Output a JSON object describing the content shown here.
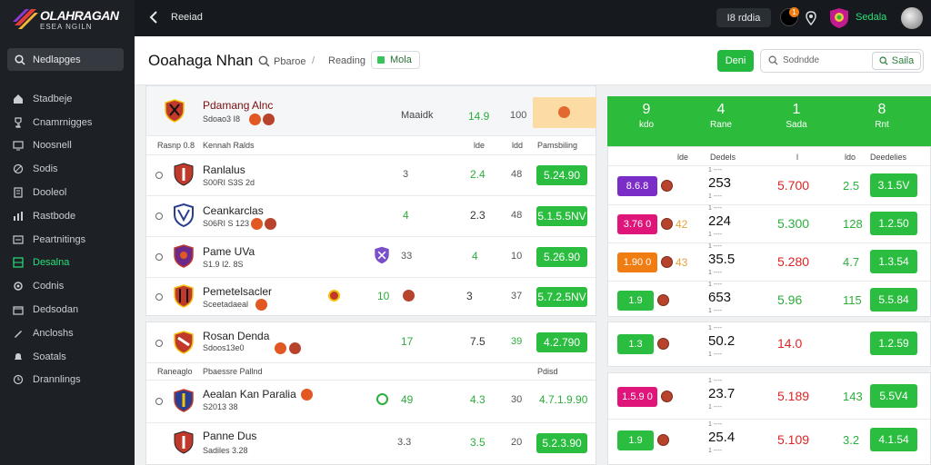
{
  "app": {
    "logo_line1": "OLAHRAGAN",
    "logo_line2": "ESEA NGILN"
  },
  "sidebar": {
    "search_label": "Nedlapges",
    "items": [
      {
        "label": "Stadbeje",
        "icon": "home-icon"
      },
      {
        "label": "Cnamrnigges",
        "icon": "trophy-icon"
      },
      {
        "label": "Noosnell",
        "icon": "monitor-icon"
      },
      {
        "label": "Sodis",
        "icon": "ball-icon"
      },
      {
        "label": "Dooleol",
        "icon": "file-icon"
      },
      {
        "label": "Rastbode",
        "icon": "chart-icon"
      },
      {
        "label": "Peartnitings",
        "icon": "list-icon"
      },
      {
        "label": "Desalna",
        "icon": "grid-icon"
      },
      {
        "label": "Codnis",
        "icon": "settings-icon"
      },
      {
        "label": "Dedsodan",
        "icon": "box-icon"
      },
      {
        "label": "Ancloshs",
        "icon": "pen-icon"
      },
      {
        "label": "Soatals",
        "icon": "bell-icon"
      },
      {
        "label": "Drannlings",
        "icon": "clock-icon"
      }
    ],
    "active_index": 7
  },
  "topbar": {
    "title": "Reeiad",
    "badge_text": "I8 rddia",
    "notif_count": "1",
    "user_label": "Sedala"
  },
  "header": {
    "title": "Ooahaga Nhan",
    "crumb1": "Pbaroe",
    "crumb2": "Reading",
    "chip": "Mola",
    "button": "Deni",
    "search_placeholder": "Sodndde",
    "search_button": "Saila"
  },
  "feature": {
    "name": "Pdamang Alnc",
    "sub": "Sdoao3 I8",
    "col_label": "Maaidk",
    "odd1": "14.9",
    "odd2": "100"
  },
  "table": {
    "col1": "Rasnp 0.8",
    "col2": "Kennah Ralds",
    "col3": "lde",
    "col4": "ldd",
    "col5": "Pamsbiling",
    "section_col1": "Raneaglo",
    "section_col2": "Pbaessre Pallnd",
    "section_col5": "Pdisd"
  },
  "rows": [
    {
      "name": "Ranlalus",
      "sub": "S00RI S3S 2d",
      "mid": "",
      "v1": "3",
      "v2": "2.4",
      "v3": "48",
      "price": "5.24.90"
    },
    {
      "name": "Ceankarclas",
      "sub": "S06RI S 123",
      "mid": "",
      "v1": "4",
      "v2": "2.3",
      "v3": "48",
      "price": "5.1.5.5NV"
    },
    {
      "name": "Pame UVa",
      "sub": "S1.9 I2. 8S",
      "mid": "33",
      "v1": "",
      "v2": "4",
      "v3": "10",
      "price": "5.26.90"
    },
    {
      "name": "Pemetelsacler",
      "sub": "Sceetadaeal",
      "mid": "10",
      "v1": "",
      "v2": "3",
      "v3": "37",
      "price": "5.7.2.5NV"
    },
    {
      "name": "Rosan Denda",
      "sub": "Sdoos13e0",
      "mid": "",
      "v1": "17",
      "v2": "7.5",
      "v3": "39",
      "price": "4.2.790"
    },
    {
      "name": "Aealan Kan Paralia",
      "sub": "S2013 38",
      "mid": "49",
      "v1": "",
      "v2": "4.3",
      "v3": "30",
      "price": "4.7.1.9.90"
    },
    {
      "name": "Panne Dus",
      "sub": "Sadiles 3.28",
      "mid": "",
      "v1": "3.3",
      "v2": "3.5",
      "v3": "20",
      "price": "5.2.3.90"
    }
  ],
  "right": {
    "head": [
      {
        "big": "9",
        "small": "kdo"
      },
      {
        "big": "4",
        "small": "Rane"
      },
      {
        "big": "1",
        "small": "Sada"
      },
      {
        "big": "8",
        "small": "Rnt"
      }
    ],
    "sub_head": {
      "c1": "lde",
      "c2": "Dedels",
      "c3": "l",
      "c4": "ldo",
      "c5": "Deedelies"
    },
    "rows": [
      {
        "tag": "8.6.8",
        "tag_color": "#7b2dc8",
        "n": "",
        "big": "253",
        "odd": "5.700",
        "odd_color": "#e02424",
        "v": "2.5",
        "price": "3.1.5V"
      },
      {
        "tag": "3.76 0",
        "tag_color": "#e0157a",
        "n": "42",
        "big": "224",
        "odd": "5.300",
        "odd_color": "#2cae3d",
        "v": "128",
        "price": "1.2.50"
      },
      {
        "tag": "1.90 0",
        "tag_color": "#f07d12",
        "n": "43",
        "big": "35.5",
        "odd": "5.280",
        "odd_color": "#e02424",
        "v": "4.7",
        "price": "1.3.54"
      },
      {
        "tag": "1.9",
        "tag_color": "#2bbd3f",
        "n": "",
        "big": "653",
        "odd": "5.96",
        "odd_color": "#2cae3d",
        "v": "115",
        "price": "5.5.84"
      },
      {
        "tag": "1.3",
        "tag_color": "#2bbd3f",
        "n": "",
        "big": "50.2",
        "odd": "14.0",
        "odd_color": "#e02424",
        "v": "",
        "price": "1.2.59"
      },
      {
        "tag": "1.5.9 0",
        "tag_color": "#e0157a",
        "n": "",
        "big": "23.7",
        "odd": "5.189",
        "odd_color": "#e02424",
        "v": "143",
        "price": "5.5V4"
      },
      {
        "tag": "1.9",
        "tag_color": "#2bbd3f",
        "n": "",
        "big": "25.4",
        "odd": "5.109",
        "odd_color": "#e02424",
        "v": "3.2",
        "price": "4.1.54"
      }
    ]
  }
}
